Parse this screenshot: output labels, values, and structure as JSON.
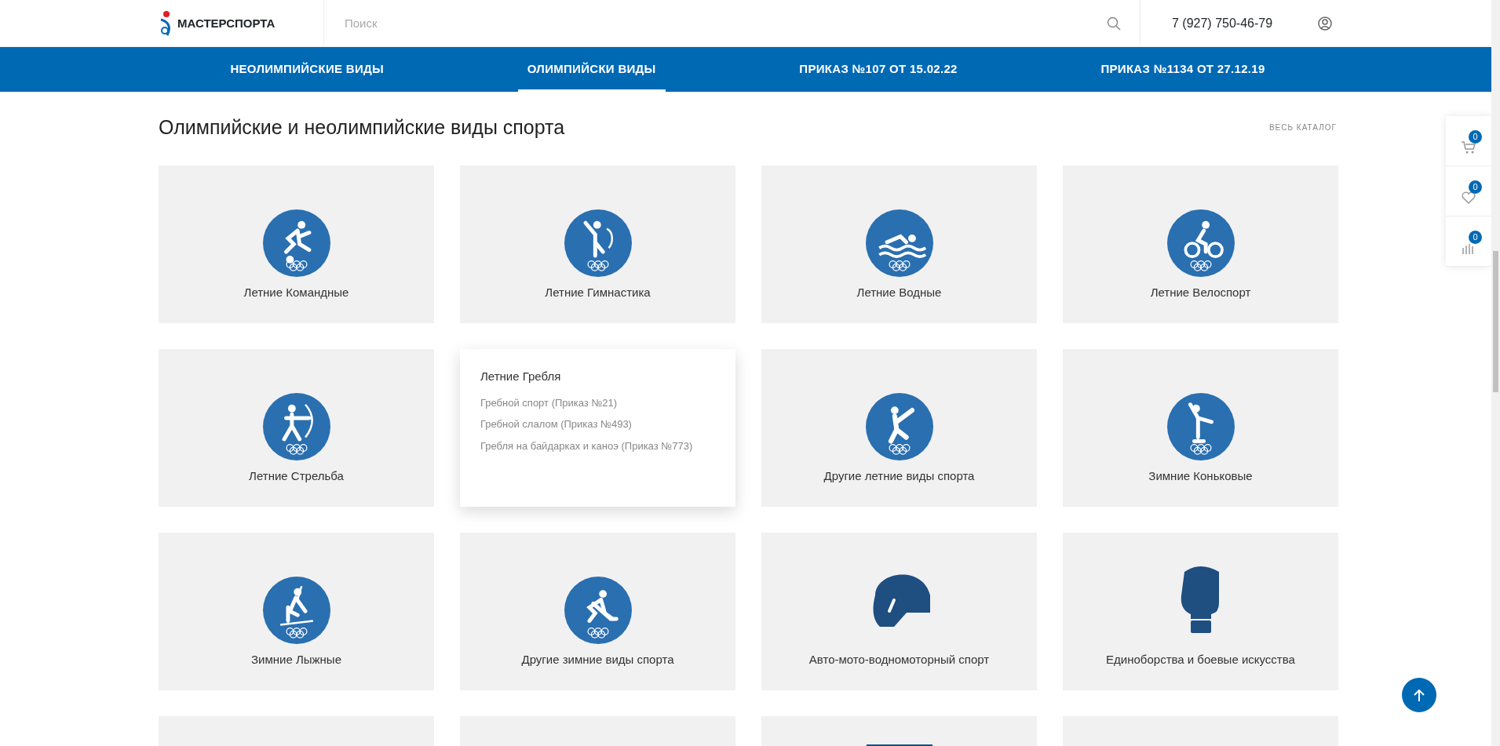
{
  "header": {
    "logo_text": "МАСТЕРСПОРТА",
    "search": {
      "placeholder": "Поиск"
    },
    "phone": "7 (927) 750-46-79"
  },
  "nav": [
    {
      "label": "НЕОЛИМПИЙСКИЕ ВИДЫ",
      "selected": false
    },
    {
      "label": "ОЛИМПИЙСКИ ВИДЫ",
      "selected": true
    },
    {
      "label": "ПРИКАЗ №107 ОТ 15.02.22",
      "selected": false
    },
    {
      "label": "ПРИКАЗ №1134 ОТ 27.12.19",
      "selected": false
    }
  ],
  "section": {
    "title": "Олимпийские и неолимпийские виды спорта",
    "catalog_link": "ВЕСЬ КАТАЛОГ"
  },
  "cards": [
    {
      "kind": "circle",
      "label": "Летние Командные"
    },
    {
      "kind": "circle",
      "label": "Летние Гимнастика"
    },
    {
      "kind": "circle",
      "label": "Летние Водные"
    },
    {
      "kind": "circle",
      "label": "Летние Велоспорт"
    },
    {
      "kind": "circle",
      "label": "Летние Стрельба"
    },
    {
      "kind": "submenu",
      "label": "Летние Гребля",
      "links": [
        "Гребной спорт (Приказ №21)",
        "Гребной слалом (Приказ №493)",
        "Гребля на байдарках и каноэ (Приказ №773)"
      ]
    },
    {
      "kind": "circle",
      "label": "Другие летние виды спорта"
    },
    {
      "kind": "circle",
      "label": "Зимние Коньковые"
    },
    {
      "kind": "circle",
      "label": "Зимние Лыжные"
    },
    {
      "kind": "circle",
      "label": "Другие зимние виды спорта"
    },
    {
      "kind": "plain",
      "label": "Авто-мото-водномоторный спорт"
    },
    {
      "kind": "plain",
      "label": "Единоборства и боевые искусства"
    },
    {
      "kind": "cut"
    },
    {
      "kind": "cut"
    },
    {
      "kind": "cut"
    },
    {
      "kind": "cut"
    }
  ],
  "side_panel": [
    {
      "kind": "cart",
      "count": "0"
    },
    {
      "kind": "heart",
      "count": "0"
    },
    {
      "kind": "chart",
      "count": "0"
    }
  ]
}
